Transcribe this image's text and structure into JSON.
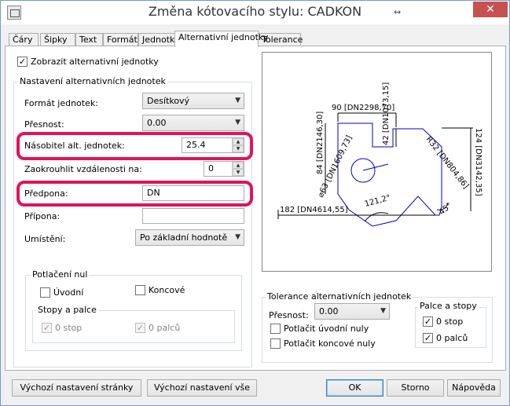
{
  "window": {
    "title": "Změna kótovacího stylu: CADKON",
    "close_glyph": "✕",
    "resize_glyph": "↔"
  },
  "tabs": [
    {
      "label": "Čáry"
    },
    {
      "label": "Šipky"
    },
    {
      "label": "Text"
    },
    {
      "label": "Formát"
    },
    {
      "label": "Jednotky"
    },
    {
      "label": "Alternativní jednotky",
      "active": true
    },
    {
      "label": "Tolerance"
    }
  ],
  "show_alt_units": {
    "label": "Zobrazit alternativní jednotky",
    "checked": true
  },
  "alt_settings": {
    "group_label": "Nastavení alternativních jednotek",
    "format_label": "Formát jednotek:",
    "format_value": "Desítkový",
    "precision_label": "Přesnost:",
    "precision_value": "0.00",
    "multiplier_label": "Násobitel alt. jednotek:",
    "multiplier_value": "25.4",
    "round_label": "Zaokrouhlit vzdálenosti na:",
    "round_value": "0",
    "prefix_label": "Předpona:",
    "prefix_value": "DN",
    "suffix_label": "Přípona:",
    "suffix_value": "",
    "placement_label": "Umístění:",
    "placement_value": "Po základní hodnotě"
  },
  "zero_suppression": {
    "group_label": "Potlačení nul",
    "leading_label": "Úvodní",
    "trailing_label": "Koncové",
    "feet_inches_label": "Stopy a palce",
    "zero_feet_label": "0 stop",
    "zero_inches_label": "0 palců"
  },
  "tolerance": {
    "group_label": "Tolerance alternativních jednotek",
    "precision_label": "Přesnost:",
    "precision_value": "0.00",
    "suppress_leading_label": "Potlačit úvodní nuly",
    "suppress_trailing_label": "Potlačit koncové nuly",
    "feet_inches": {
      "group_label": "Palce a stopy",
      "zero_feet_label": "0 stop",
      "zero_inches_label": "0 palců"
    }
  },
  "preview": {
    "dim_top": "90 [DN2298,70]",
    "dim_left_outer": "84 [DN2146,30]",
    "dim_inner": "42 [DN1073,15]",
    "dim_diameter": "⌀63 [DN1609,73]",
    "dim_radius": "R32 [DN804,86]",
    "dim_right": "124 [DN3142,35]",
    "dim_bottom": "182 [DN4614,55]",
    "angle_1": "121,2°",
    "angle_2": "45°"
  },
  "buttons": {
    "page_defaults": "Výchozí nastavení stránky",
    "all_defaults": "Výchozí nastavení vše",
    "ok": "OK",
    "cancel": "Storno",
    "help": "Nápověda"
  },
  "colors": {
    "highlight": "#e0145a",
    "preview_lines": "#0000cc"
  }
}
